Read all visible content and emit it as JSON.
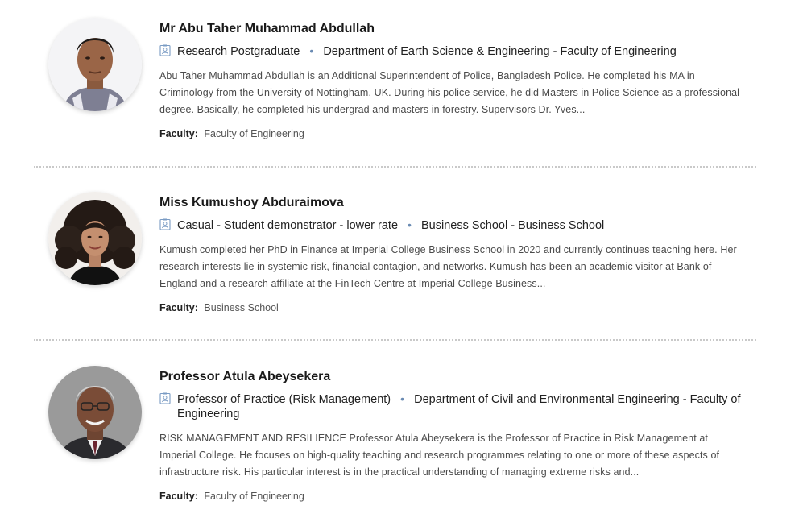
{
  "people": [
    {
      "name": "Mr Abu Taher Muhammad Abdullah",
      "role": "Research Postgraduate",
      "department": "Department of Earth Science & Engineering - Faculty of Engineering",
      "summary": "Abu Taher Muhammad Abdullah is an Additional Superintendent of Police, Bangladesh Police. He completed his MA in Criminology from the University of Nottingham, UK. During his police service, he did Masters in Police Science as a professional degree. Basically, he completed his undergrad and masters in forestry. Supervisors Dr. Yves...",
      "faculty_label": "Faculty:",
      "faculty": "Faculty of Engineering"
    },
    {
      "name": "Miss Kumushoy Abduraimova",
      "role": "Casual - Student demonstrator - lower rate",
      "department": "Business School - Business School",
      "summary": "Kumush completed her PhD in Finance at Imperial College Business School in 2020 and currently continues teaching here. Her research interests lie in systemic risk, financial contagion, and networks. Kumush has been an academic visitor at Bank of England and a research affiliate at the FinTech Centre at Imperial College Business...",
      "faculty_label": "Faculty:",
      "faculty": "Business School"
    },
    {
      "name": "Professor Atula Abeysekera",
      "role": "Professor of Practice (Risk Management)",
      "department": "Department of Civil and Environmental Engineering - Faculty of Engineering",
      "summary": "RISK MANAGEMENT AND RESILIENCE Professor Atula Abeysekera is the Professor of Practice in Risk Management at Imperial College. He focuses on high-quality teaching and research programmes relating to one or more of these aspects of infrastructure risk. His particular interest is in the practical understanding of managing extreme risks and...",
      "faculty_label": "Faculty:",
      "faculty": "Faculty of Engineering"
    }
  ],
  "separator": "•",
  "icons": {
    "role": "id-badge-icon"
  },
  "colors": {
    "icon_accent": "#7b9cc4",
    "divider": "#c9c9c9"
  }
}
